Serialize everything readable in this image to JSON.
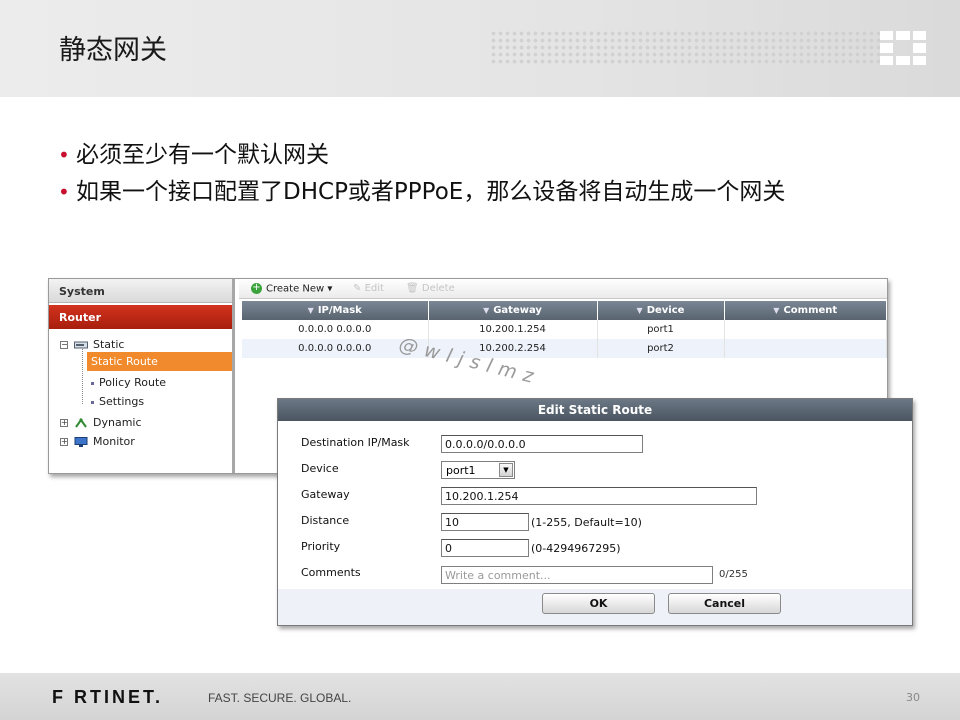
{
  "slide": {
    "title": "静态网关",
    "bullets": [
      "必须至少有一个默认网关",
      "如果一个接口配置了DHCP或者PPPoE，那么设备将自动生成一个网关"
    ],
    "bullet_marker": "•",
    "watermark": "@wljslmz",
    "page_number": "30"
  },
  "nav": {
    "system": "System",
    "router": "Router",
    "static": "Static",
    "static_route": "Static Route",
    "policy_route": "Policy Route",
    "settings": "Settings",
    "dynamic": "Dynamic",
    "monitor": "Monitor"
  },
  "toolbar": {
    "create_new": "Create New",
    "edit": "Edit",
    "delete": "Delete"
  },
  "table": {
    "columns": [
      "IP/Mask",
      "Gateway",
      "Device",
      "Comment"
    ],
    "rows": [
      [
        "0.0.0.0 0.0.0.0",
        "10.200.1.254",
        "port1",
        ""
      ],
      [
        "0.0.0.0 0.0.0.0",
        "10.200.2.254",
        "port2",
        ""
      ]
    ]
  },
  "dialog": {
    "title": "Edit Static Route",
    "dest_label": "Destination IP/Mask",
    "dest_value": "0.0.0.0/0.0.0.0",
    "device_label": "Device",
    "device_value": "port1",
    "gateway_label": "Gateway",
    "gateway_value": "10.200.1.254",
    "distance_label": "Distance",
    "distance_value": "10",
    "distance_hint": "(1-255, Default=10)",
    "priority_label": "Priority",
    "priority_value": "0",
    "priority_hint": "(0-4294967295)",
    "comments_label": "Comments",
    "comments_placeholder": "Write a comment...",
    "comments_counter": "0/255",
    "ok_label": "OK",
    "cancel_label": "Cancel"
  },
  "footer": {
    "brand": "F RTINET.",
    "tagline": "FAST. SECURE. GLOBAL."
  },
  "colors": {
    "accent_red": "#c8102e",
    "nav_router": "#b8260f",
    "nav_selected": "#f08a2c",
    "grid_header": "#5e6975"
  },
  "icons": {
    "logo": "fortinet-logo-icon",
    "create": "plus-icon",
    "edit": "pencil-icon",
    "delete": "trash-icon",
    "filter": "filter-icon",
    "select": "chevron-down-icon"
  }
}
